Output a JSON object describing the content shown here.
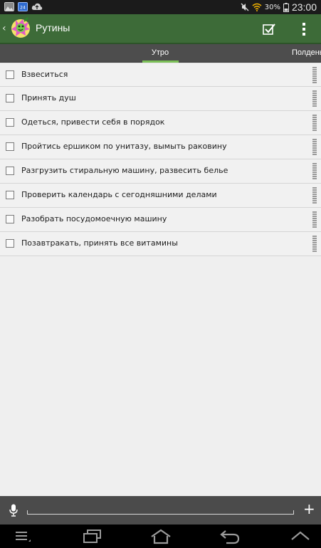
{
  "status_bar": {
    "battery_percent": "30%",
    "time": "23:00"
  },
  "action_bar": {
    "title": "Рутины"
  },
  "tabs": {
    "active": "Утро",
    "next": "Полдень"
  },
  "tasks": [
    {
      "label": "Взвеситься",
      "checked": false
    },
    {
      "label": "Принять душ",
      "checked": false
    },
    {
      "label": "Одеться, привести себя в порядок",
      "checked": false
    },
    {
      "label": "Пройтись ершиком по унитазу, вымыть раковину",
      "checked": false
    },
    {
      "label": "Разгрузить стиральную машину, развесить белье",
      "checked": false
    },
    {
      "label": "Проверить календарь с сегодняшними делами",
      "checked": false
    },
    {
      "label": "Разобрать посудомоечную машину",
      "checked": false
    },
    {
      "label": "Позавтракать, принять все витамины",
      "checked": false
    }
  ],
  "input": {
    "value": "",
    "placeholder": ""
  },
  "icons": {
    "status_left": [
      "photo-icon",
      "calendar-24-icon",
      "cloud-upload-icon"
    ],
    "status_right": [
      "mute-icon",
      "wifi-icon",
      "battery-icon"
    ],
    "action": [
      "back-chevron-icon",
      "app-logo",
      "checkbox-check-icon",
      "overflow-menu-icon"
    ],
    "bottom": [
      "microphone-icon",
      "plus-icon"
    ],
    "nav": [
      "menu-icon",
      "recent-apps-icon",
      "home-icon",
      "back-icon",
      "up-icon"
    ]
  },
  "colors": {
    "action_bar": "#3d6b38",
    "tab_indicator": "#7bbf57",
    "tabs_bg": "#4d4d4d"
  }
}
